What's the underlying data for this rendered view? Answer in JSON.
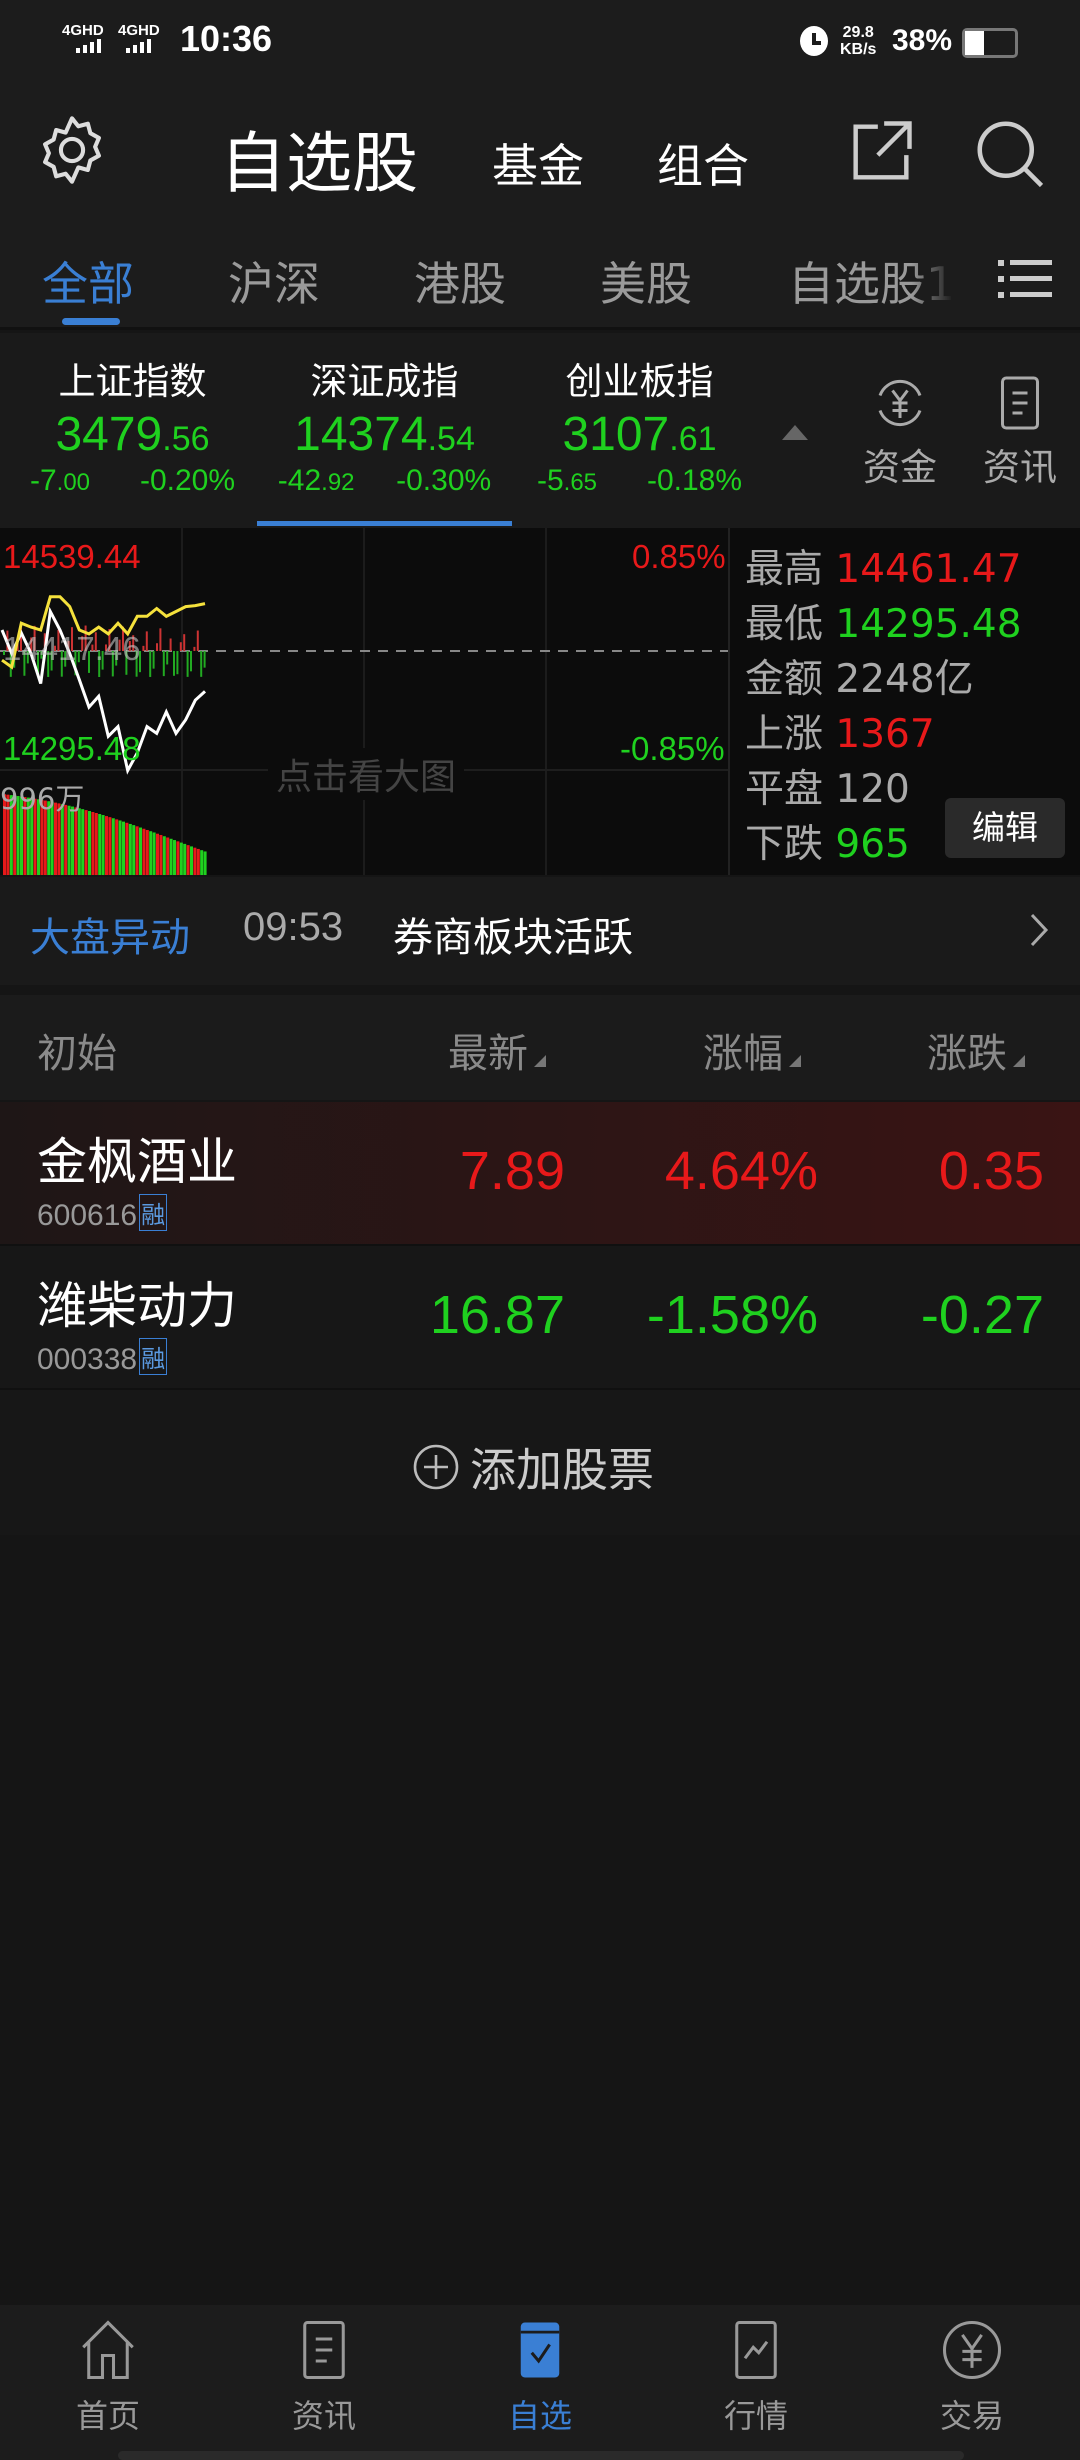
{
  "status_bar": {
    "network1": "4GHD",
    "network2": "4GHD",
    "time": "10:36",
    "speed": "29.8",
    "speed_unit": "KB/s",
    "battery": "38%",
    "battery_level": 0.38
  },
  "header": {
    "title": "自选股",
    "fund_tab": "基金",
    "portfolio_tab": "组合"
  },
  "tabs": [
    {
      "label": "全部",
      "active": true
    },
    {
      "label": "沪深"
    },
    {
      "label": "港股"
    },
    {
      "label": "美股"
    },
    {
      "label": "自选股1"
    }
  ],
  "indices": [
    {
      "name": "上证指数",
      "value_int": "3479",
      "value_dec": ".56",
      "change_int": "-7",
      "change_dec": ".00",
      "pct": "-0.20%"
    },
    {
      "name": "深证成指",
      "value_int": "14374",
      "value_dec": ".54",
      "change_int": "-42",
      "change_dec": ".92",
      "pct": "-0.30%",
      "selected": true
    },
    {
      "name": "创业板指",
      "value_int": "3107",
      "value_dec": ".61",
      "change_int": "-5",
      "change_dec": ".65",
      "pct": "-0.18%"
    }
  ],
  "side_buttons": {
    "funds": "资金",
    "news": "资讯"
  },
  "chart_data": {
    "type": "line",
    "max_label": "14539.44",
    "min_label": "14295.48",
    "prev_close_label": "14417.46",
    "max_pct": "0.85%",
    "min_pct": "-0.85%",
    "volume_label": "996万",
    "overlay_hint": "点击看大图",
    "ylim": [
      14295.48,
      14539.44
    ],
    "prev_close": 14417.46,
    "series": [
      {
        "color": "#ffffff",
        "values": [
          14439,
          14415,
          14436,
          14415,
          14384,
          14458,
          14439,
          14415,
          14388,
          14360,
          14371,
          14330,
          14340,
          14295,
          14313,
          14340,
          14333,
          14355,
          14333,
          14347,
          14367,
          14376
        ]
      },
      {
        "color": "#f5e13c",
        "values": [
          14408,
          14401,
          14446,
          14442,
          14439,
          14473,
          14473,
          14463,
          14439,
          14435,
          14442,
          14435,
          14446,
          14435,
          14453,
          14453,
          14461,
          14453,
          14458,
          14463,
          14464,
          14466
        ]
      }
    ]
  },
  "stats": {
    "high_label": "最高",
    "high": "14461.47",
    "low_label": "最低",
    "low": "14295.48",
    "amount_label": "金额",
    "amount": "2248亿",
    "up_label": "上涨",
    "up": "1367",
    "flat_label": "平盘",
    "flat": "120",
    "down_label": "下跌",
    "down": "965",
    "edit_button": "编辑"
  },
  "alert": {
    "label": "大盘异动",
    "time": "09:53",
    "text": "券商板块活跃"
  },
  "list": {
    "headers": {
      "sort": "初始",
      "latest": "最新",
      "pct": "涨幅",
      "change": "涨跌"
    },
    "rows": [
      {
        "name": "金枫酒业",
        "code": "600616",
        "tag": "融",
        "price": "7.89",
        "pct": "4.64%",
        "change": "0.35",
        "direction": "up"
      },
      {
        "name": "潍柴动力",
        "code": "000338",
        "tag": "融",
        "price": "16.87",
        "pct": "-1.58%",
        "change": "-0.27",
        "direction": "down"
      }
    ],
    "add_label": "添加股票"
  },
  "nav": [
    {
      "label": "首页"
    },
    {
      "label": "资讯"
    },
    {
      "label": "自选",
      "active": true
    },
    {
      "label": "行情"
    },
    {
      "label": "交易"
    }
  ],
  "colors": {
    "accent": "#3a7fd4",
    "up": "#e8191a",
    "down": "#1fd11f"
  }
}
